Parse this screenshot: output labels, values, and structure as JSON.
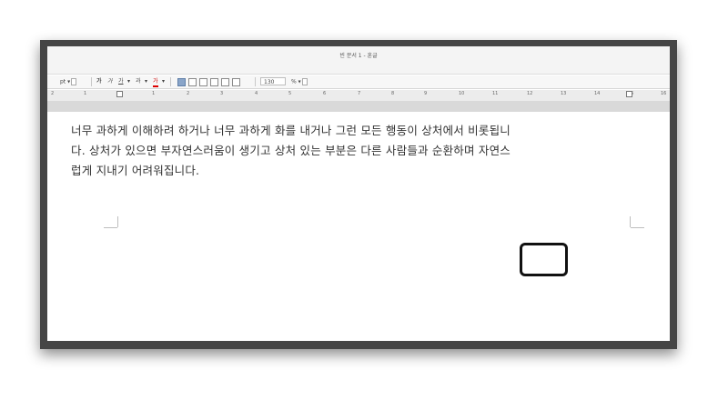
{
  "window": {
    "title": "빈 문서 1 - 훈글"
  },
  "toolbar": {
    "unit": "pt",
    "bold": "가",
    "italic": "가",
    "underline": "가",
    "strike": "과",
    "font_color": "가",
    "line_spacing_value": "130",
    "line_spacing_unit": "%"
  },
  "ruler": {
    "numbers": [
      "2",
      "1",
      "1",
      "2",
      "3",
      "4",
      "5",
      "6",
      "7",
      "8",
      "9",
      "10",
      "11",
      "12",
      "13",
      "14",
      "15",
      "16"
    ]
  },
  "document": {
    "lines": [
      "너무 과하게 이해하려 하거나 너무 과하게 화를 내거나 그런 모든 행동이 상처에서 비롯됩니",
      "다. 상처가 있으면 부자연스러움이 생기고 상처 있는 부분은 다른 사람들과 순환하며 자연스",
      "럽게 지내기 어려워집니다."
    ]
  },
  "annotation": {
    "highlighted_word": "순환"
  }
}
